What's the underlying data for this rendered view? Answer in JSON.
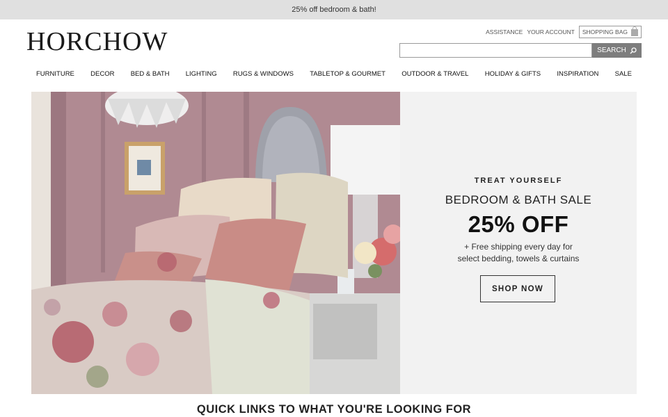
{
  "promo": {
    "text": "25% off bedroom & bath!"
  },
  "header": {
    "logo": "HORCHOW",
    "utility": {
      "assistance": "ASSISTANCE",
      "account": "YOUR ACCOUNT",
      "bag": "SHOPPING BAG"
    },
    "search": {
      "value": "",
      "placeholder": "",
      "button": "SEARCH"
    }
  },
  "nav": {
    "items": [
      {
        "label": "FURNITURE"
      },
      {
        "label": "DECOR"
      },
      {
        "label": "BED & BATH"
      },
      {
        "label": "LIGHTING"
      },
      {
        "label": "RUGS & WINDOWS"
      },
      {
        "label": "TABLETOP & GOURMET"
      },
      {
        "label": "OUTDOOR & TRAVEL"
      },
      {
        "label": "HOLIDAY & GIFTS"
      },
      {
        "label": "INSPIRATION"
      },
      {
        "label": "SALE"
      }
    ]
  },
  "hero": {
    "eyebrow": "TREAT YOURSELF",
    "title": "BEDROOM & BATH SALE",
    "discount": "25% OFF",
    "note_line1": "+ Free shipping every day for",
    "note_line2": "select bedding, towels & curtains",
    "cta": "SHOP NOW"
  },
  "quick_links": {
    "heading": "QUICK LINKS TO WHAT YOU'RE LOOKING FOR"
  },
  "colors": {
    "promo_bg": "#e0e0e0",
    "search_button": "#7d7d7d",
    "hero_panel": "#f2f2f2",
    "wall": "#b08a92"
  }
}
